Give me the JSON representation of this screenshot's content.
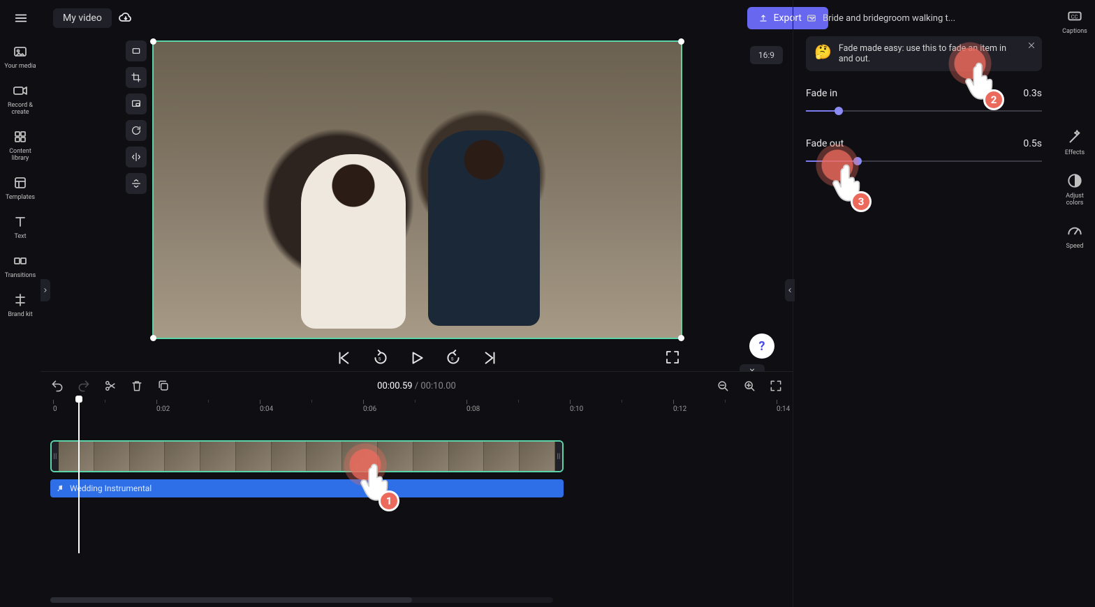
{
  "topbar": {
    "project_title": "My video",
    "export_label": "Export"
  },
  "left_rail": {
    "items": [
      {
        "label": "Your media"
      },
      {
        "label": "Record & create"
      },
      {
        "label": "Content library"
      },
      {
        "label": "Templates"
      },
      {
        "label": "Text"
      },
      {
        "label": "Transitions"
      },
      {
        "label": "Brand kit"
      }
    ]
  },
  "preview": {
    "aspect_label": "16:9"
  },
  "timeline": {
    "current_time": "00:00.59",
    "separator": " / ",
    "total_time": "00:10.00",
    "ruler_ticks": [
      "0",
      "0:02",
      "0:04",
      "0:06",
      "0:08",
      "0:10",
      "0:12",
      "0:14"
    ],
    "audio_clip_label": "Wedding Instrumental"
  },
  "right_panel": {
    "clip_title": "Bride and bridegroom walking t...",
    "tip_text": "Fade made easy: use this to fade an item in and out.",
    "fade_in": {
      "label": "Fade in",
      "value_text": "0.3s",
      "fill_pct": 14
    },
    "fade_out": {
      "label": "Fade out",
      "value_text": "0.5s",
      "fill_pct": 22
    }
  },
  "far_rail": {
    "items": [
      {
        "label": "Captions"
      },
      {
        "label": "Effects"
      },
      {
        "label": "Adjust colors"
      },
      {
        "label": "Speed"
      }
    ]
  },
  "annotations": {
    "n1": "1",
    "n2": "2",
    "n3": "3"
  },
  "colors": {
    "accent": "#6767f0",
    "selection": "#5ad4a8",
    "audio_clip": "#2e6fe8",
    "annotation": "#ec6a5c"
  }
}
